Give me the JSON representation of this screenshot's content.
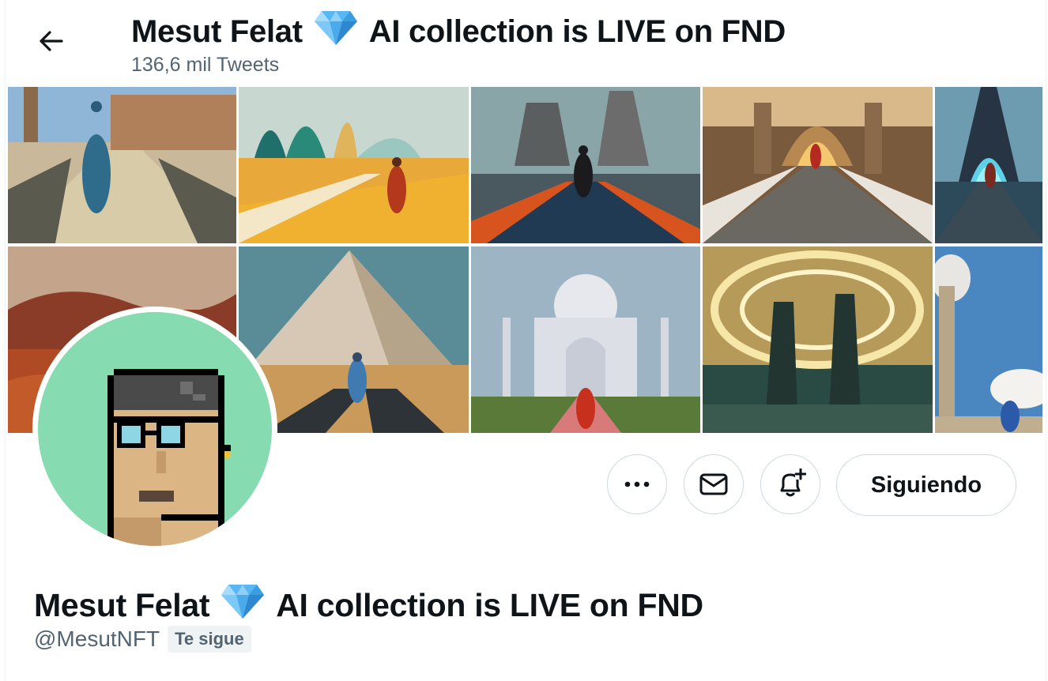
{
  "header": {
    "name": "Mesut Felat",
    "name_suffix": "AI collection is LIVE on FND",
    "tweet_count": "136,6 mil Tweets"
  },
  "banner": {
    "tiles": [
      "traveler-stone-road-tile",
      "orange-path-arches-tile",
      "cooling-towers-path-tile",
      "ornate-palace-walkway-tile",
      "eiffel-tower-tile",
      "red-canyon-tile",
      "pyramid-tile",
      "taj-mahal-tile",
      "portal-towers-tile",
      "tall-tower-sky-tile"
    ]
  },
  "actions": {
    "more_icon": "more-icon",
    "message_icon": "envelope-icon",
    "notify_icon": "bell-plus-icon",
    "follow_label": "Siguiendo"
  },
  "profile": {
    "name": "Mesut Felat",
    "name_suffix": "AI collection is LIVE on FND",
    "handle": "@MesutNFT",
    "follows_you": "Te sigue"
  },
  "colors": {
    "text": "#0f1419",
    "secondary": "#536471",
    "border": "#cfd9de",
    "avatar_bg": "#86dbb0",
    "gem": "#4fb3f0"
  }
}
